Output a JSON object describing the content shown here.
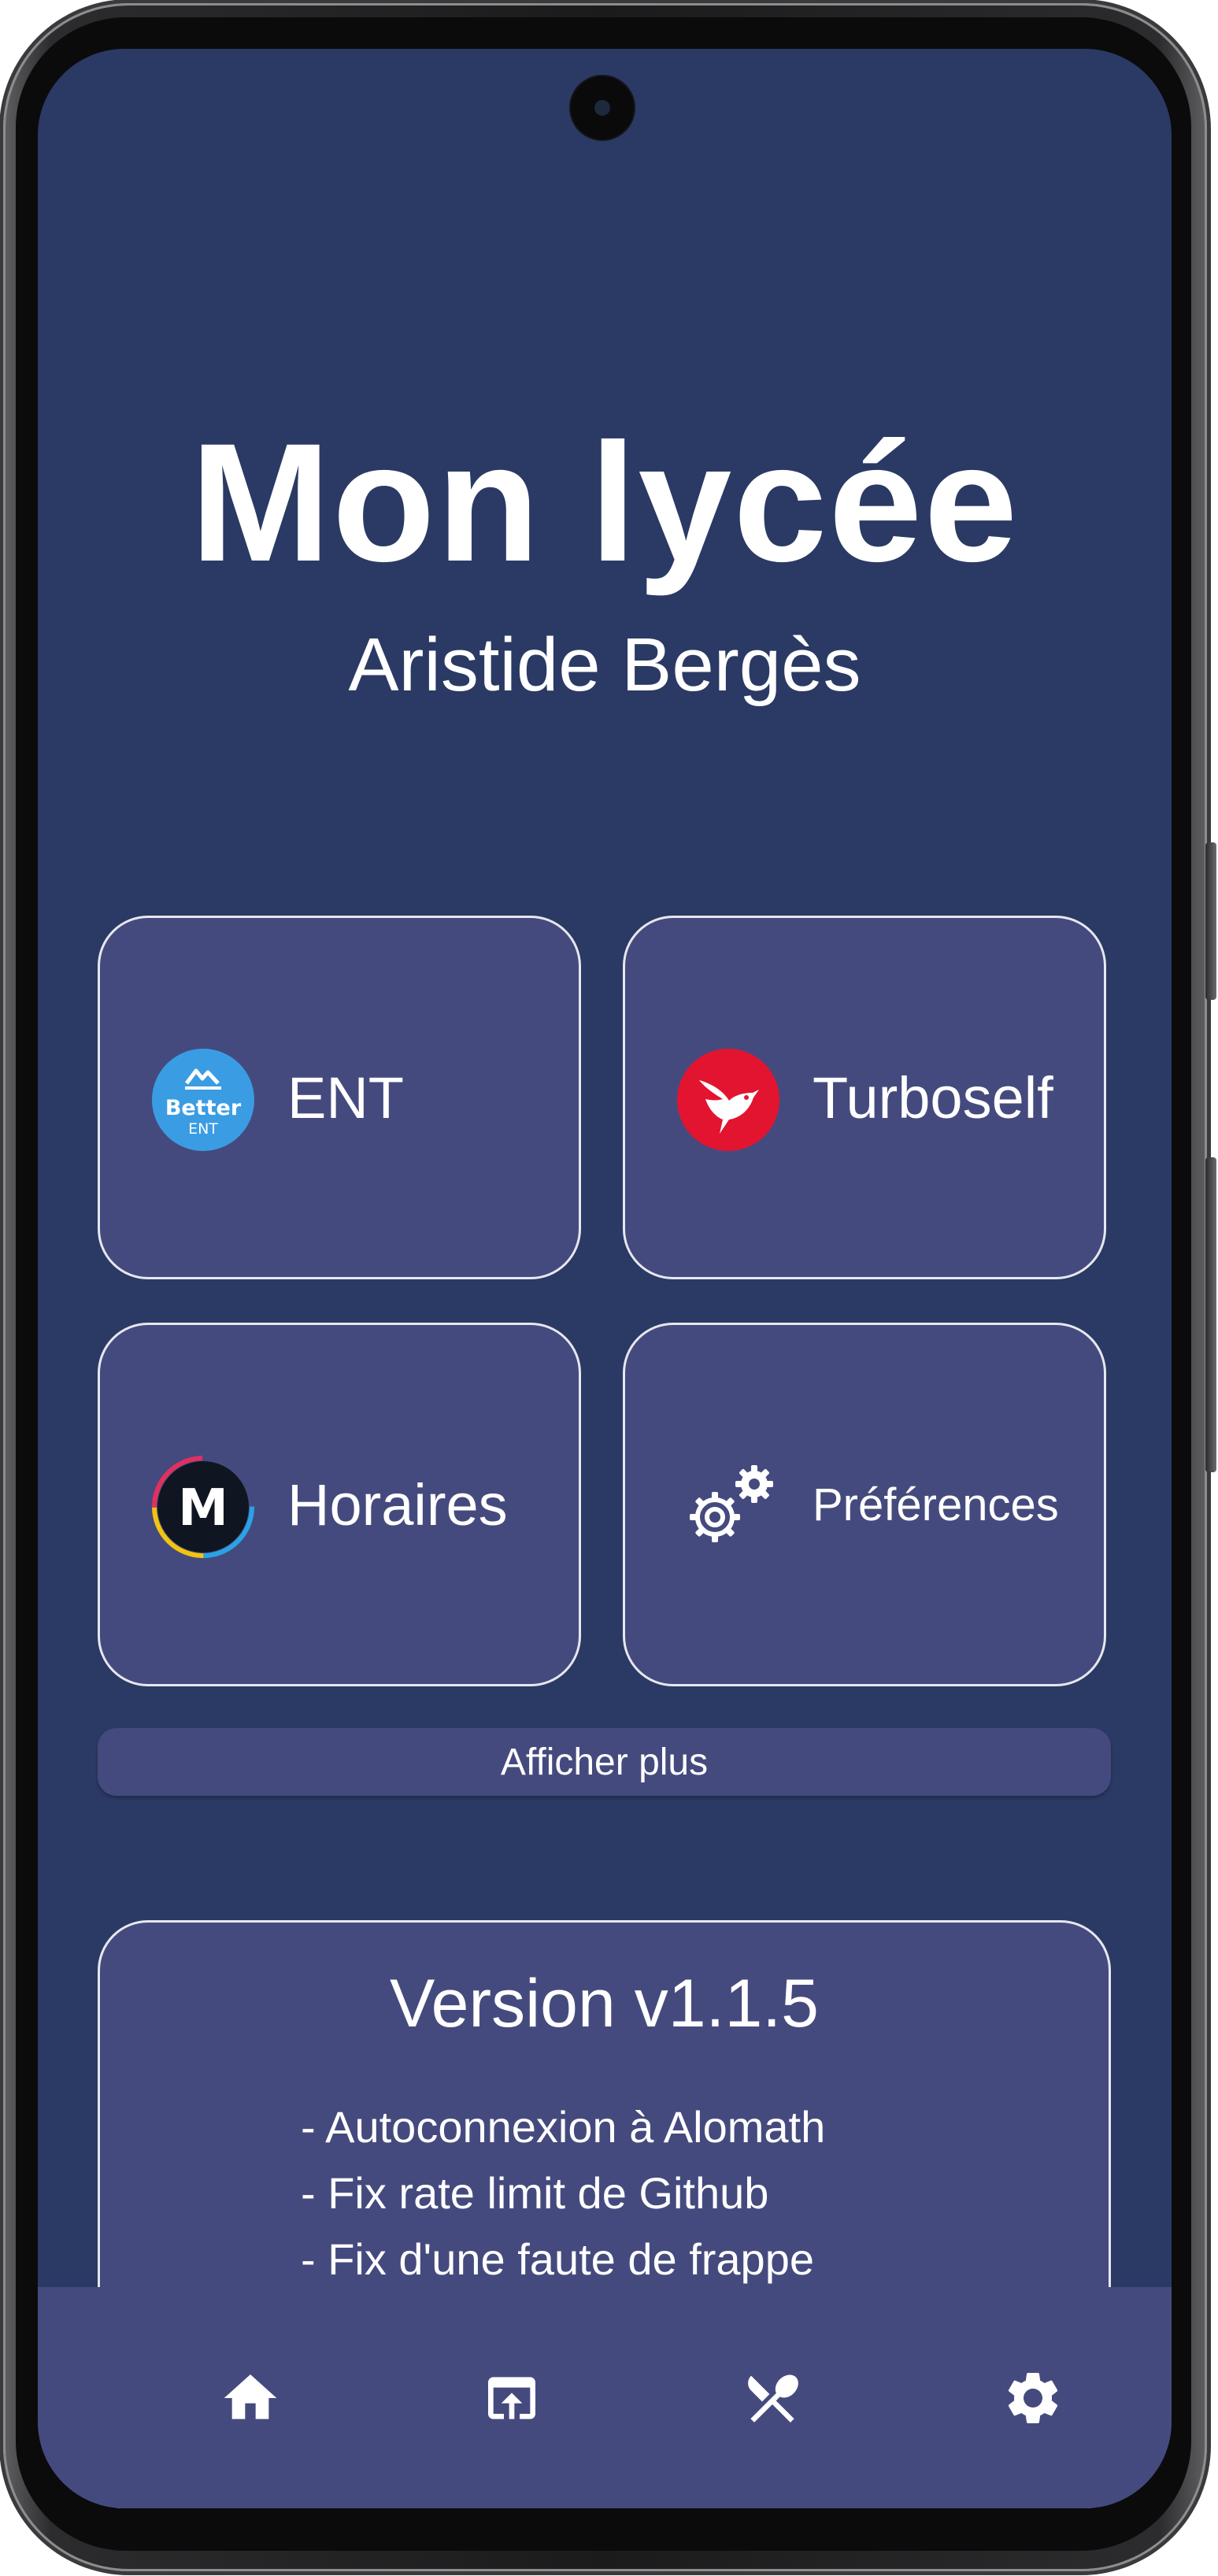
{
  "app": {
    "title": "Mon lycée",
    "subtitle": "Aristide Bergès"
  },
  "tiles": [
    {
      "label": "ENT",
      "icon": "better-ent-logo-icon",
      "icon_text_main": "Better",
      "icon_text_sub": "ENT",
      "icon_color": "#3a9de3"
    },
    {
      "label": "Turboself",
      "icon": "turboself-hummingbird-icon",
      "icon_color": "#e3142f"
    },
    {
      "label": "Horaires",
      "icon": "horaires-m-logo-icon",
      "icon_text_main": "M"
    },
    {
      "label": "Préférences",
      "icon": "gears-icon"
    }
  ],
  "more_button": {
    "label": "Afficher plus"
  },
  "version": {
    "title": "Version v1.1.5",
    "changes": [
      "- Autoconnexion à Alomath",
      "- Fix rate limit de Github",
      "- Fix d'une faute de frappe"
    ]
  },
  "bottom_nav": [
    {
      "name": "home",
      "icon": "home-icon"
    },
    {
      "name": "open-in-browser",
      "icon": "open-in-browser-icon"
    },
    {
      "name": "restaurant",
      "icon": "cutlery-icon"
    },
    {
      "name": "settings",
      "icon": "gear-icon"
    }
  ],
  "colors": {
    "background": "#2b3a64",
    "card": "#454a7e",
    "card_border": "#e6e7f0",
    "text": "#ffffff"
  }
}
